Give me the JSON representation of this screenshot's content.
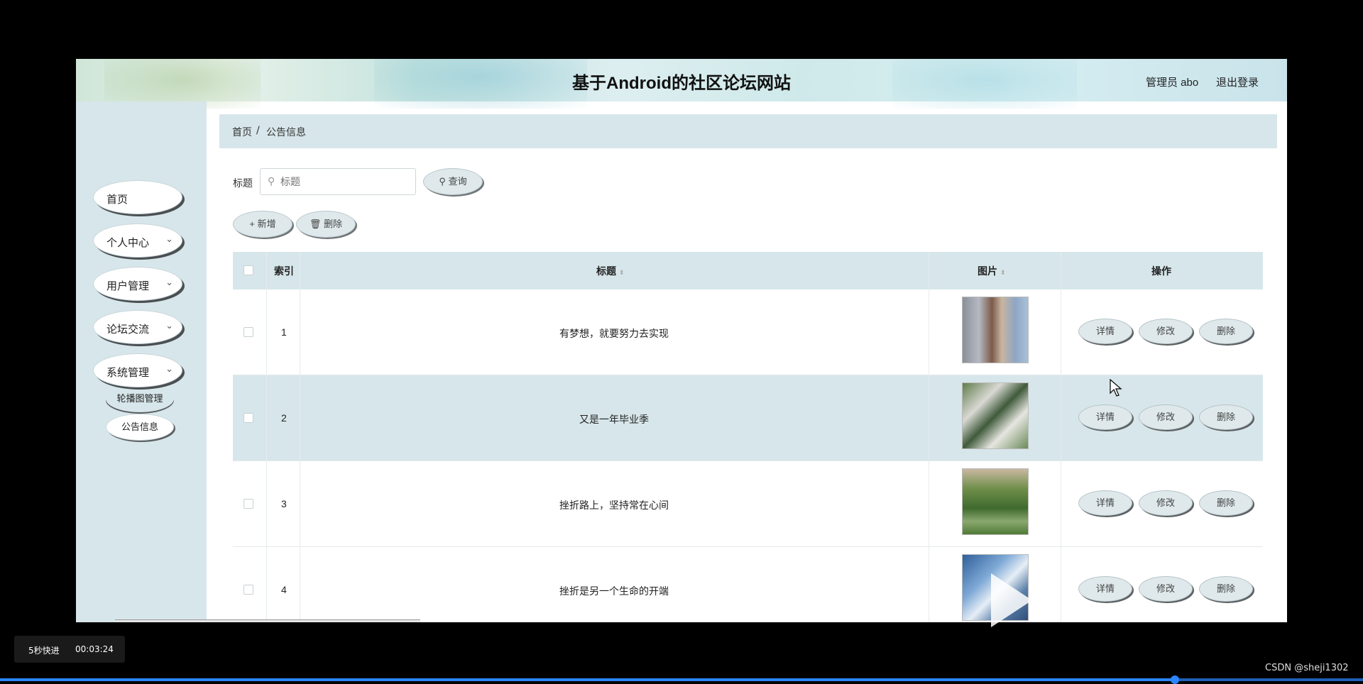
{
  "header": {
    "title": "基于Android的社区论坛网站",
    "admin": "管理员 abo",
    "logout": "退出登录"
  },
  "sidebar": {
    "items": [
      {
        "label": "首页",
        "has_chevron": false
      },
      {
        "label": "个人中心",
        "has_chevron": true
      },
      {
        "label": "用户管理",
        "has_chevron": true
      },
      {
        "label": "论坛交流",
        "has_chevron": true
      },
      {
        "label": "系统管理",
        "has_chevron": true
      }
    ],
    "sub_items": [
      {
        "label": "轮播图管理"
      },
      {
        "label": "公告信息"
      }
    ]
  },
  "breadcrumb": {
    "home": "首页",
    "separator": "/",
    "current": "公告信息"
  },
  "search": {
    "label": "标题",
    "placeholder": "标题",
    "button": "查询"
  },
  "toolbar": {
    "add": "新增",
    "delete": "删除"
  },
  "table": {
    "headers": {
      "index": "索引",
      "title": "标题",
      "image": "图片",
      "actions": "操作"
    },
    "rows": [
      {
        "index": "1",
        "title": "有梦想，就要努力去实现",
        "image": "building-photo"
      },
      {
        "index": "2",
        "title": "又是一年毕业季",
        "image": "people-photo"
      },
      {
        "index": "3",
        "title": "挫折路上，坚持常在心间",
        "image": "garden-photo"
      },
      {
        "index": "4",
        "title": "挫折是另一个生命的开端",
        "image": "tower-photo"
      }
    ],
    "row_actions": {
      "detail": "详情",
      "edit": "修改",
      "delete": "删除"
    }
  },
  "player": {
    "skip_label": "5秒快进",
    "time": "00:03:24",
    "progress_percent": 86,
    "credit": "CSDN @sheji1302"
  },
  "colors": {
    "panel": "#d7e6ea",
    "background": "#000000",
    "progress": "#2b86ff"
  }
}
